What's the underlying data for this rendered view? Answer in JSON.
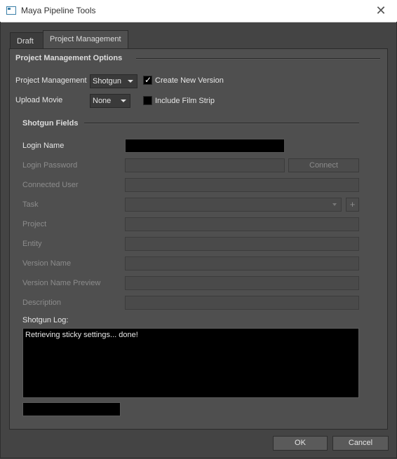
{
  "window": {
    "title": "Maya Pipeline Tools",
    "close_glyph": "✕"
  },
  "tabs": [
    {
      "label": "Draft",
      "active": false
    },
    {
      "label": "Project Management",
      "active": true
    }
  ],
  "pm_options": {
    "group_title": "Project Management Options",
    "project_management_label": "Project Management",
    "project_management_value": "Shotgun",
    "create_new_version_label": "Create New Version",
    "create_new_version_checked": true,
    "upload_movie_label": "Upload Movie",
    "upload_movie_value": "None",
    "include_film_strip_label": "Include Film Strip",
    "include_film_strip_checked": false
  },
  "shotgun": {
    "group_title": "Shotgun Fields",
    "login_name_label": "Login Name",
    "login_name_value": "",
    "login_password_label": "Login Password",
    "connect_label": "Connect",
    "connected_user_label": "Connected User",
    "task_label": "Task",
    "task_add_glyph": "+",
    "project_label": "Project",
    "entity_label": "Entity",
    "version_name_label": "Version Name",
    "version_name_preview_label": "Version Name Preview",
    "description_label": "Description",
    "log_label": "Shotgun Log:",
    "log_text": "Retrieving sticky settings... done!"
  },
  "footer": {
    "ok_label": "OK",
    "cancel_label": "Cancel"
  },
  "icons": {
    "app": "window-icon",
    "check": "✓"
  },
  "colors": {
    "panel_bg": "#4f4f4f",
    "field_bg": "#000000",
    "disabled_text": "#8c8c8c"
  }
}
